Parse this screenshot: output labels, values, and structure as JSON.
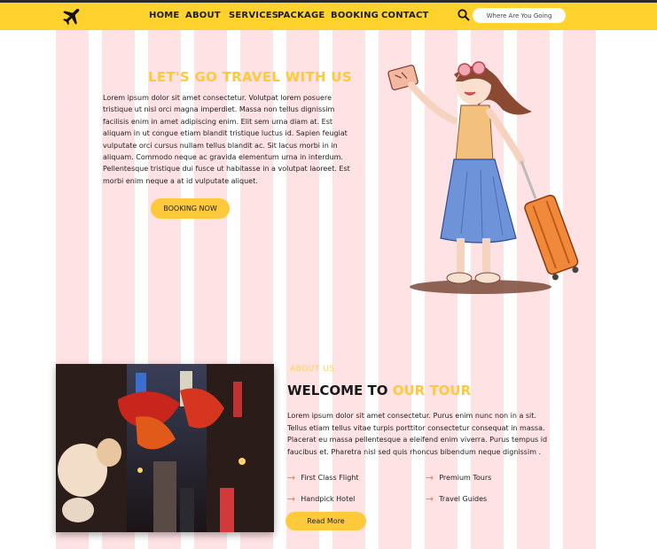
{
  "nav": {
    "logo_icon": "airplane-icon",
    "items": [
      {
        "label": "HOME"
      },
      {
        "label": "ABOUT"
      },
      {
        "label": "SERVICES"
      },
      {
        "label": "PACKAGE"
      },
      {
        "label": "BOOKING"
      },
      {
        "label": "CONTACT"
      }
    ],
    "search_icon": "search-icon",
    "search_placeholder": "Where Are You Going"
  },
  "hero": {
    "title": "LET'S GO TRAVEL WITH US",
    "text": "Lorem ipsum dolor sit amet consectetur. Volutpat lorem posuere tristique ut nisl orci magna imperdiet. Massa non tellus dignissim facilisis enim in amet adipiscing enim. Elit sem urna diam at. Est aliquam in ut congue etiam blandit tristique luctus id. Sapien feugiat vulputate orci cursus nullam tellus blandit ac. Sit lacus morbi in in aliquam. Commodo neque ac gravida elementum urna in interdum. Pellentesque tristique dui fusce ut habitasse in a volutpat laoreet. Est morbi enim neque a at id vulputate aliquet.",
    "button": "BOOKING NOW"
  },
  "about": {
    "label": "ABOUT US",
    "title_main": "WELCOME TO",
    "title_accent": "OUR TOUR",
    "text": "Lorem ipsum dolor sit amet consectetur. Purus enim nunc non in a sit. Tellus etiam tellus vitae turpis porttitor consectetur consequat in massa. Placerat eu massa pellentesque a eleifend enim viverra. Purus tempus id faucibus et. Pharetra nisl sed quis rhoncus bibendum neque dignissim .",
    "features": [
      "First Class Flight",
      "Premium Tours",
      "Handpick Hotel",
      "Travel Guides"
    ],
    "button": "Read More"
  },
  "colors": {
    "accent_yellow": "#ffc93c",
    "topbar_yellow": "#ffd22e",
    "arrow_orange": "#ff7a3d",
    "grid_pink": "#ffd0d5"
  }
}
